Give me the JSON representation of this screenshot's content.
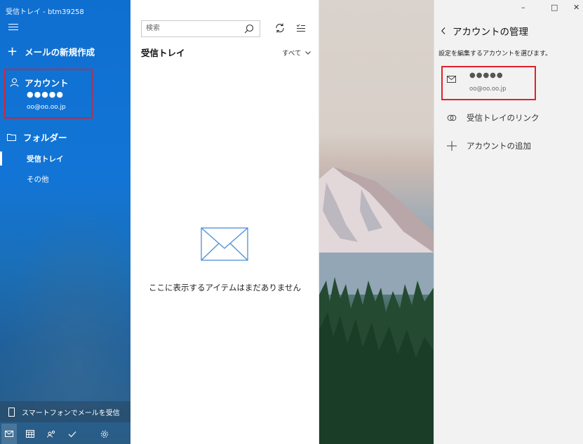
{
  "window": {
    "title": "受信トレイ - btm39258",
    "min": "–",
    "max": "□",
    "close": "✕"
  },
  "sidebar": {
    "new_mail": "メールの新規作成",
    "account_label": "アカウント",
    "account_name": "●●●●●",
    "account_email": "oo@oo.oo.jp",
    "folders_label": "フォルダー",
    "folders": [
      "受信トレイ",
      "その他"
    ],
    "phone_prompt": "スマートフォンでメールを受信",
    "bottom_icons": [
      "mail-icon",
      "calendar-icon",
      "people-icon",
      "todo-icon",
      "settings-icon"
    ]
  },
  "list": {
    "search_placeholder": "検索",
    "folder_title": "受信トレイ",
    "filter": "すべて",
    "empty_text": "ここに表示するアイテムはまだありません"
  },
  "manage": {
    "title": "アカウントの管理",
    "subtitle": "設定を編集するアカウントを選びます。",
    "account_name": "●●●●●",
    "account_email": "oo@oo.oo.jp",
    "link_inboxes": "受信トレイのリンク",
    "add_account": "アカウントの追加"
  },
  "colors": {
    "accent": "#0f6fd1",
    "highlight": "#e2202a"
  }
}
